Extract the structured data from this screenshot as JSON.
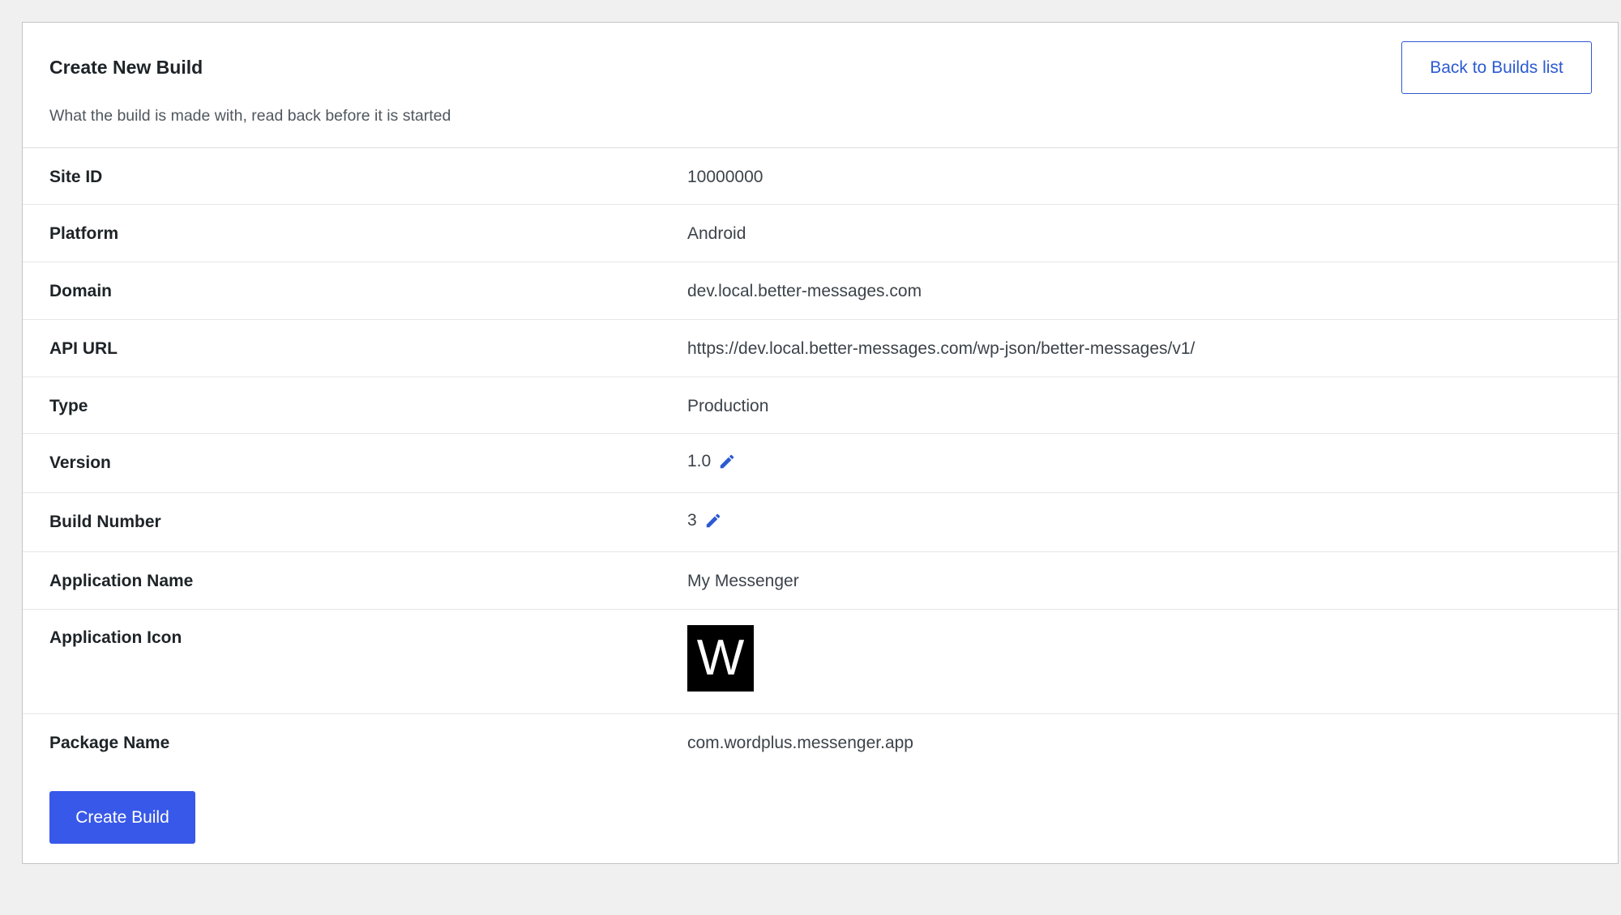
{
  "header": {
    "title": "Create New Build",
    "subtitle": "What the build is made with, read back before it is started",
    "back_button_label": "Back to Builds list"
  },
  "details": [
    {
      "label": "Site ID",
      "value": "10000000"
    },
    {
      "label": "Platform",
      "value": "Android"
    },
    {
      "label": "Domain",
      "value": "dev.local.better-messages.com"
    },
    {
      "label": "API URL",
      "value": "https://dev.local.better-messages.com/wp-json/better-messages/v1/"
    },
    {
      "label": "Type",
      "value": "Production"
    },
    {
      "label": "Version",
      "value": "1.0",
      "icon": "pencil-icon"
    },
    {
      "label": "Build Number",
      "value": "3",
      "icon": "pencil-icon"
    },
    {
      "label": "Application Name",
      "value": "My Messenger"
    },
    {
      "label": "Application Icon",
      "icon_letter": "W"
    },
    {
      "label": "Package Name",
      "value": "com.wordplus.messenger.app"
    }
  ],
  "footer": {
    "create_button_label": "Create Build"
  },
  "colors": {
    "accent": "#3858e9",
    "link": "#2c5ad2",
    "background": "#f0f0f1",
    "app_icon_bg": "#000000"
  }
}
